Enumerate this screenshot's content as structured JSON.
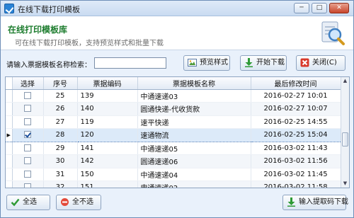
{
  "window": {
    "title": "在线下载打印模板",
    "min_label": "─",
    "max_label": "□",
    "close_label": "✕"
  },
  "header": {
    "title": "在线打印模板库",
    "subtitle": "可在线下载打印模板，支持预览样式和批量下载"
  },
  "toolbar": {
    "search_label": "请输入票据模板名称检索：",
    "search_value": "",
    "preview_label": "预览样式",
    "download_label": "开始下载",
    "close_label": "关闭(C)"
  },
  "table": {
    "columns": [
      "选择",
      "序号",
      "票据编码",
      "票据模板名称",
      "最后修改时间"
    ],
    "rows": [
      {
        "checked": false,
        "seq": "25",
        "code": "139",
        "name": "中通速递03",
        "time": "2016-02-27 10:01"
      },
      {
        "checked": false,
        "seq": "26",
        "code": "140",
        "name": "圆通快递-代收货款",
        "time": "2016-02-27 10:07"
      },
      {
        "checked": false,
        "seq": "27",
        "code": "119",
        "name": "速平快递",
        "time": "2016-02-25 14:55"
      },
      {
        "checked": true,
        "seq": "28",
        "code": "120",
        "name": "速通物流",
        "time": "2016-02-25 15:04"
      },
      {
        "checked": false,
        "seq": "29",
        "code": "141",
        "name": "中通速递05",
        "time": "2016-03-02 11:43"
      },
      {
        "checked": false,
        "seq": "30",
        "code": "142",
        "name": "圆通速递06",
        "time": "2016-03-02 11:56"
      },
      {
        "checked": false,
        "seq": "31",
        "code": "150",
        "name": "中通速递04",
        "time": "2016-03-02 11:45"
      },
      {
        "checked": false,
        "seq": "32",
        "code": "151",
        "name": "申通速递02",
        "time": "2016-03-02 11:58"
      }
    ],
    "selected_row": 3
  },
  "bottom": {
    "select_all_label": "全选",
    "select_none_label": "全不选",
    "import_label": "输入提取码下载"
  },
  "colors": {
    "accent_green": "#1e7d2f",
    "frame_blue": "#6f8fb8",
    "selection": "#dceaf9"
  },
  "icons": {
    "app": "app-check-icon",
    "logo": "magnifier-document-icon",
    "preview": "preview-image-icon",
    "download": "download-arrow-icon",
    "close": "close-x-icon",
    "select_all": "green-check-icon",
    "select_none": "red-no-icon",
    "import": "download-arrow-icon"
  }
}
